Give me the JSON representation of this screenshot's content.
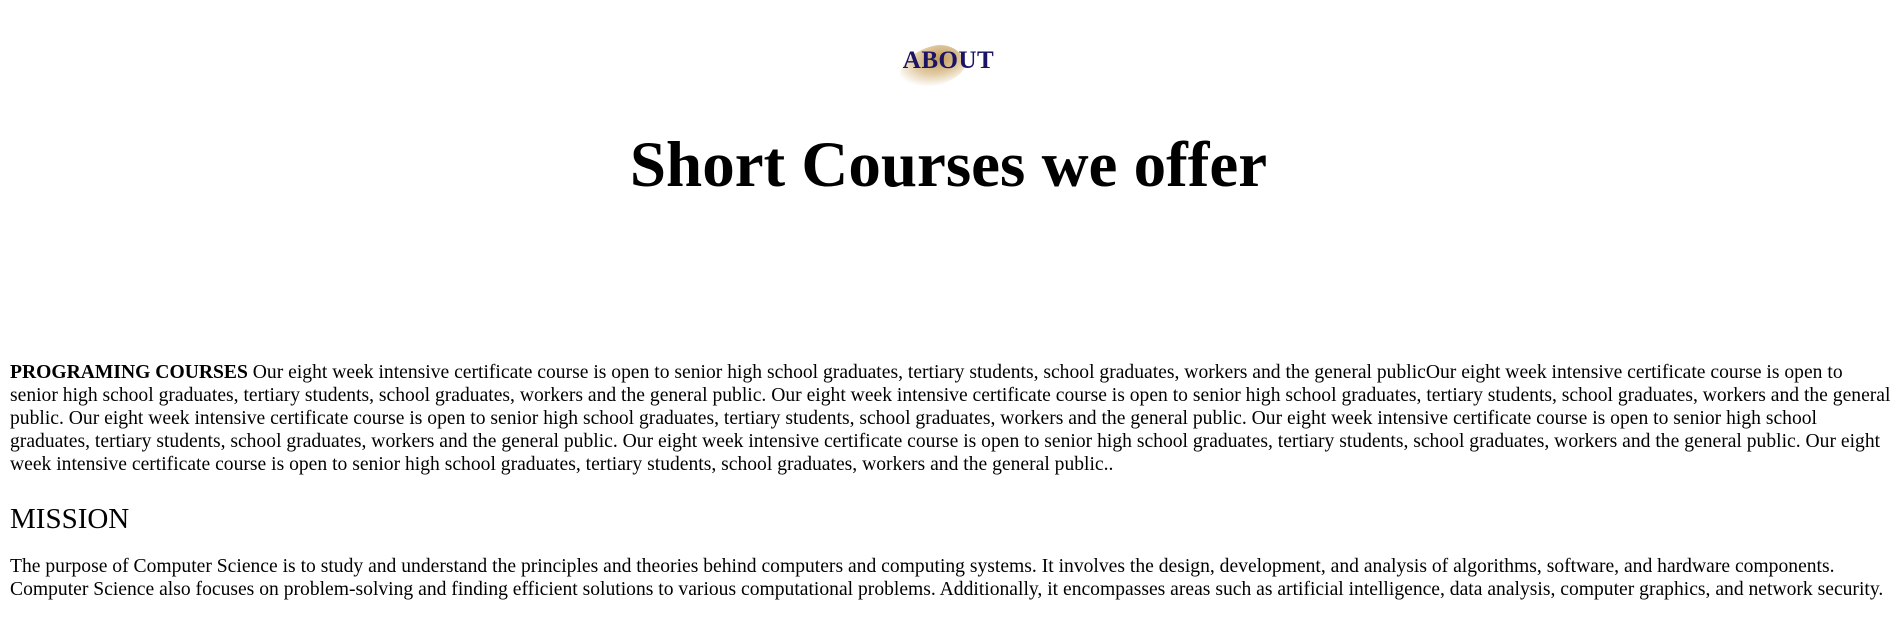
{
  "about": {
    "label": "ABOUT"
  },
  "hero": {
    "title": "Short Courses we offer"
  },
  "courses": {
    "heading": "PROGRAMING COURSES",
    "body": " Our eight week intensive certificate course is open to senior high school graduates, tertiary students, school graduates, workers and the general publicOur eight week intensive certificate course is open to senior high school graduates, tertiary students, school graduates, workers and the general public. Our eight week intensive certificate course is open to senior high school graduates, tertiary students, school graduates, workers and the general public. Our eight week intensive certificate course is open to senior high school graduates, tertiary students, school graduates, workers and the general public. Our eight week intensive certificate course is open to senior high school graduates, tertiary students, school graduates, workers and the general public. Our eight week intensive certificate course is open to senior high school graduates, tertiary students, school graduates, workers and the general public. Our eight week intensive certificate course is open to senior high school graduates, tertiary students, school graduates, workers and the general public.."
  },
  "mission": {
    "heading": "MISSION",
    "body": "The purpose of Computer Science is to study and understand the principles and theories behind computers and computing systems. It involves the design, development, and analysis of algorithms, software, and hardware components. Computer Science also focuses on problem-solving and finding efficient solutions to various computational problems. Additionally, it encompasses areas such as artificial intelligence, data analysis, computer graphics, and network security."
  },
  "colors": {
    "about_text": "#1b1464",
    "about_swoosh": "#b88a3c",
    "body_text": "#000000",
    "background": "#ffffff"
  }
}
